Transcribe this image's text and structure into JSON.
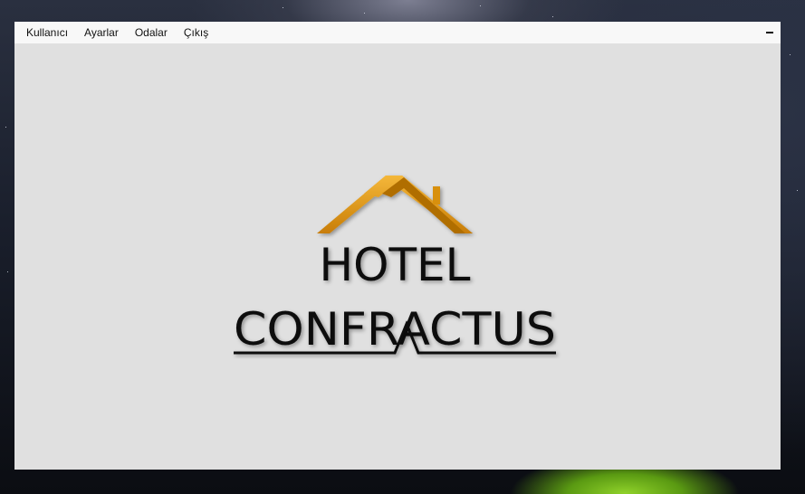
{
  "menu": {
    "items": [
      {
        "label": "Kullanıcı"
      },
      {
        "label": "Ayarlar"
      },
      {
        "label": "Odalar"
      },
      {
        "label": "Çıkış"
      }
    ]
  },
  "window_controls": {
    "minimize_label": "–"
  },
  "logo": {
    "line1": "HOTEL",
    "line2": "CONFRACTUS",
    "roof_color": "#e39a16",
    "text_color": "#0d0d0d"
  },
  "colors": {
    "window_bg": "#e0e0e0",
    "menubar_bg": "#f8f8f8"
  }
}
